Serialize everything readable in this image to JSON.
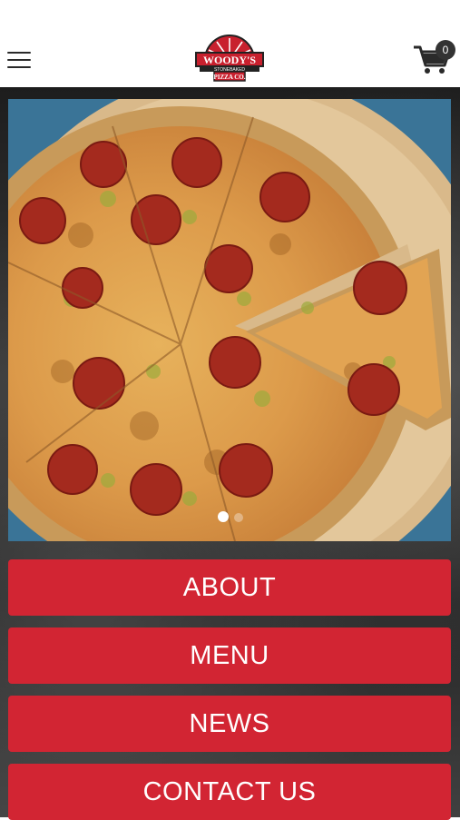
{
  "header": {
    "menu_icon": "hamburger-menu-icon",
    "logo": {
      "line1": "WOODY'S",
      "line2": "STONEBAKED",
      "line3": "PIZZA CO."
    },
    "cart_icon": "shopping-cart-icon",
    "cart_count": "0"
  },
  "carousel": {
    "image": "pepperoni-pizza-photo",
    "dots_total": 2,
    "active_dot": 1
  },
  "nav": {
    "about": "ABOUT",
    "menu": "MENU",
    "news": "NEWS",
    "contact": "CONTACT US"
  },
  "colors": {
    "brand_red": "#d22533",
    "header_bg": "#ffffff",
    "background": "#2a2a2a"
  }
}
